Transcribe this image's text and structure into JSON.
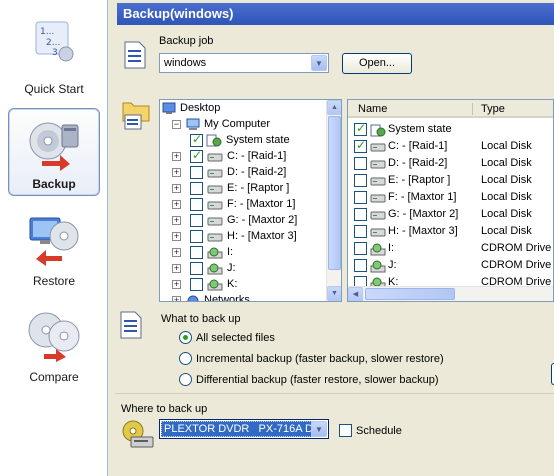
{
  "nav": {
    "items": [
      {
        "label": "Quick Start",
        "icon": "quick-start-icon"
      },
      {
        "label": "Backup",
        "icon": "backup-icon",
        "active": true
      },
      {
        "label": "Restore",
        "icon": "restore-icon"
      },
      {
        "label": "Compare",
        "icon": "compare-icon"
      }
    ]
  },
  "header": {
    "title": "Backup(windows)"
  },
  "job": {
    "label": "Backup job",
    "value": "windows",
    "open_label": "Open..."
  },
  "tree": {
    "items": [
      {
        "label": "Desktop"
      },
      {
        "label": "My Computer"
      },
      {
        "label": "System state",
        "checked": true
      },
      {
        "label": "C: - [Raid-1]",
        "checked": true
      },
      {
        "label": "D: - [Raid-2]",
        "checked": false
      },
      {
        "label": "E: - [Raptor ]",
        "checked": false
      },
      {
        "label": "F: - [Maxtor 1]",
        "checked": false
      },
      {
        "label": "G: - [Maxtor 2]",
        "checked": false
      },
      {
        "label": "H: - [Maxtor 3]",
        "checked": false
      },
      {
        "label": "I:",
        "checked": false
      },
      {
        "label": "J:",
        "checked": false
      },
      {
        "label": "K:",
        "checked": false
      },
      {
        "label": "Networks"
      }
    ]
  },
  "list": {
    "col_name": "Name",
    "col_type": "Type",
    "rows": [
      {
        "name": "System state",
        "type": "",
        "checked": true
      },
      {
        "name": "C: - [Raid-1]",
        "type": "Local Disk",
        "checked": true
      },
      {
        "name": "D: - [Raid-2]",
        "type": "Local Disk",
        "checked": false
      },
      {
        "name": "E: - [Raptor ]",
        "type": "Local Disk",
        "checked": false
      },
      {
        "name": "F: - [Maxtor 1]",
        "type": "Local Disk",
        "checked": false
      },
      {
        "name": "G: - [Maxtor 2]",
        "type": "Local Disk",
        "checked": false
      },
      {
        "name": "H: - [Maxtor 3]",
        "type": "Local Disk",
        "checked": false
      },
      {
        "name": "I:",
        "type": "CDROM Drive",
        "checked": false
      },
      {
        "name": "J:",
        "type": "CDROM Drive",
        "checked": false
      },
      {
        "name": "K:",
        "type": "CDROM Drive",
        "checked": false
      }
    ]
  },
  "what": {
    "label": "What to back up",
    "options": [
      {
        "label": "All selected files",
        "selected": true
      },
      {
        "label": "Incremental backup (faster backup, slower restore)",
        "selected": false
      },
      {
        "label": "Differential backup (faster restore, slower backup)",
        "selected": false
      }
    ]
  },
  "where": {
    "label": "Where to back up",
    "device": "PLEXTOR DVDR   PX-716A D",
    "schedule_label": "Schedule",
    "schedule_checked": false
  },
  "colors": {
    "header": "#3a61c4",
    "accent": "#21a121"
  }
}
